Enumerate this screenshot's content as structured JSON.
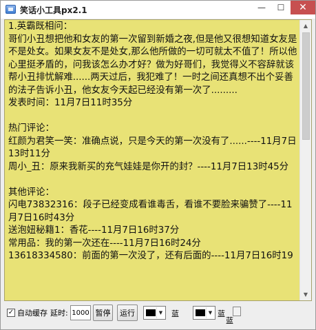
{
  "window": {
    "title": "笑话小工具px2.1",
    "minimize_glyph": "—",
    "maximize_glyph": "☐",
    "close_glyph": "✕"
  },
  "content": {
    "lines": [
      "1.英霸既相问：",
      "哥们小丑想把他和女友的第一次留到新婚之夜,但是他又很想知道女友是不是处女。如果女友不是处女,那么他所做的一切可就太不值了！所以他心里挺矛盾的，问我该怎么办才好？做为好哥们，我觉得义不容辞就该帮小丑排忧解难......两天过后，我犯难了！一时之间还真想不出个妥善的法子告诉小丑，他女友今天起已经没有第一次了.........",
      "发表时间：11月7日11时35分",
      "",
      "热门评论：",
      "红颜为君笑一笑：准确点说，只是今天的第一次没有了......----11月7日13时11分",
      "周小_丑：原来我新买的充气娃娃是你开的封？----11月7日13时45分",
      "",
      "其他评论：",
      "闪电73832316：段子已经变成看谁毒舌，看谁不要脸来骗赞了----11月7日16时43分",
      "送泡妞秘籍1：香花----11月7日16时37分",
      "常用品：我的第一次还在----11月7日16时24分",
      "13618334580：前面的第一次没了，还有后面的----11月7日16时19"
    ],
    "bg_color": "#e8e276"
  },
  "toolbar": {
    "auto_cache_label": "自动缓存",
    "auto_cache_checked": true,
    "check_glyph": "✓",
    "delay_label": "延时:",
    "delay_value": "1000",
    "pause_label": "暂停",
    "run_label": "运行",
    "color1_label": "蓝",
    "color2_label": "蓝",
    "color3_label": "蓝"
  },
  "icons": {
    "app": "app-window-icon",
    "scroll_up": "▲",
    "scroll_down": "▼",
    "dropdown": "▼"
  }
}
